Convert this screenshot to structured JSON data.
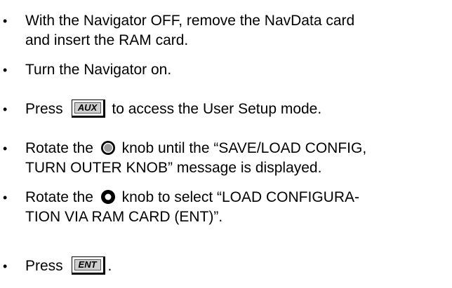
{
  "steps": [
    {
      "bullet": "•",
      "lines": [
        "With the Navigator OFF, remove the NavData card",
        "and insert the RAM card."
      ]
    },
    {
      "bullet": "•",
      "lines": [
        "Turn the Navigator on."
      ]
    },
    {
      "bullet": "•",
      "before": "Press",
      "key": "AUX",
      "after": "to access the User Setup mode."
    },
    {
      "bullet": "•",
      "before": "Rotate the",
      "knob_icon": "inner-knob-icon",
      "after": "knob until the “SAVE/LOAD CONFIG,",
      "line2": "TURN OUTER KNOB” message is displayed."
    },
    {
      "bullet": "•",
      "before": "Rotate the",
      "knob_icon": "outer-knob-icon",
      "after": "knob to select “LOAD CONFIGURA-",
      "line2": "TION VIA RAM CARD  (ENT)”."
    },
    {
      "bullet": "•",
      "before": "Press",
      "key": "ENT",
      "after": "."
    }
  ]
}
